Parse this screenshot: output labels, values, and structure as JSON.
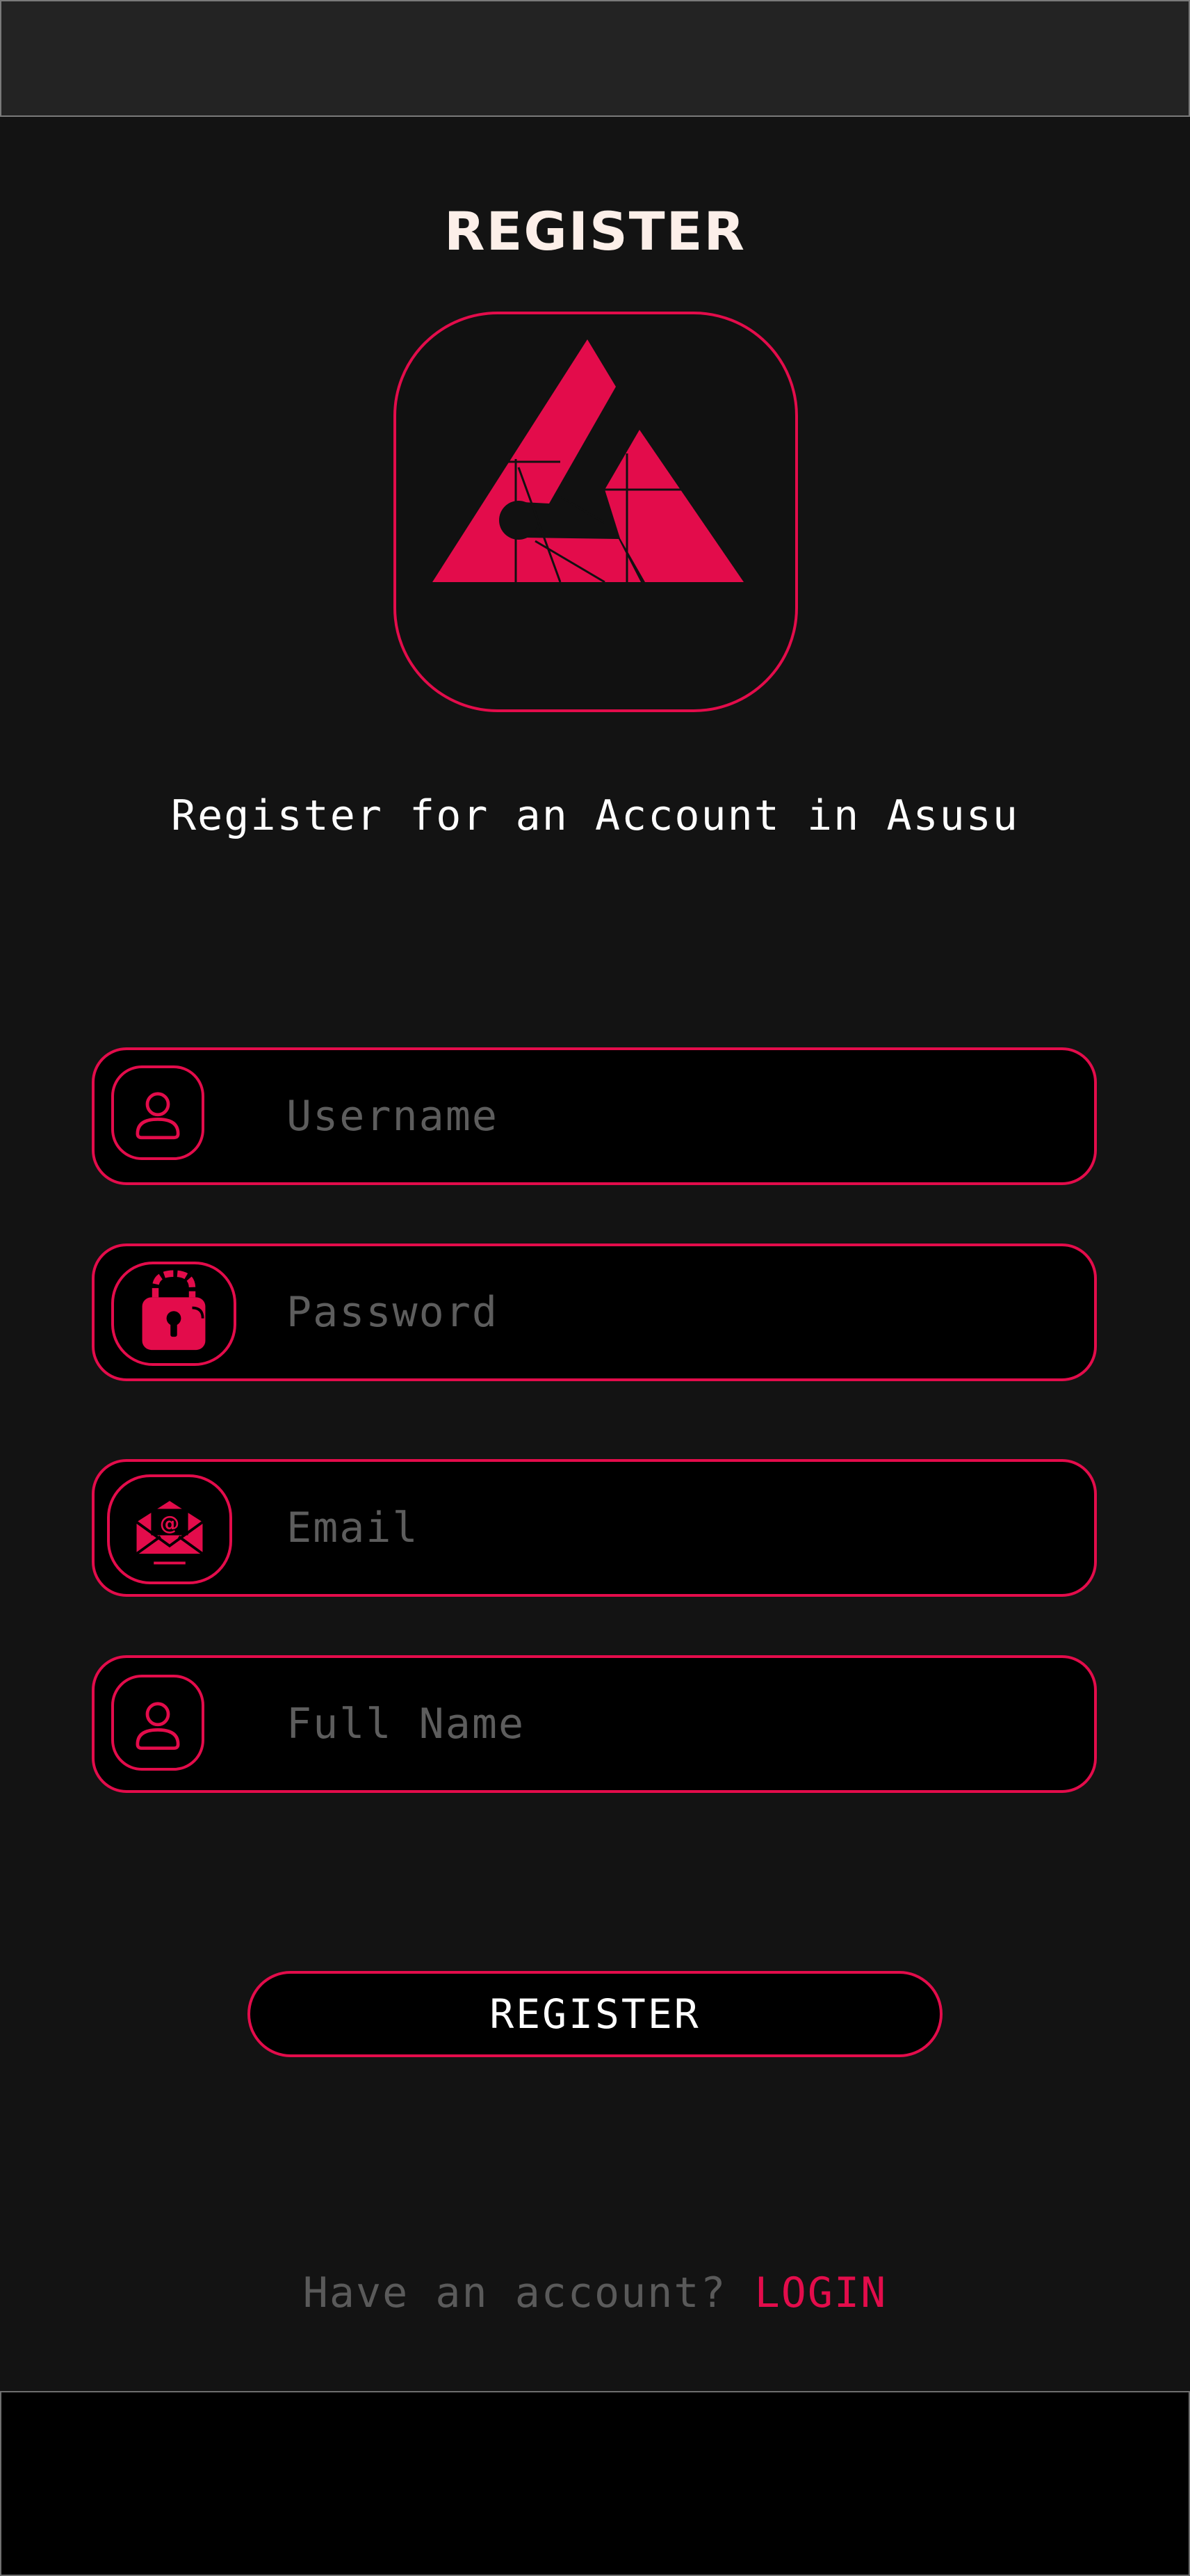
{
  "page": {
    "title": "REGISTER",
    "subtitle": "Register for an Account in Asusu"
  },
  "logo": {
    "name": "asusu-logo-icon"
  },
  "form": {
    "username": {
      "placeholder": "Username",
      "value": "",
      "icon": "user-icon"
    },
    "password": {
      "placeholder": "Password",
      "value": "",
      "icon": "lock-icon"
    },
    "email": {
      "placeholder": "Email",
      "value": "",
      "icon": "mail-icon"
    },
    "full_name": {
      "placeholder": "Full Name",
      "value": "",
      "icon": "user-icon"
    }
  },
  "register_button": "REGISTER",
  "footer": {
    "prompt": "Have an account?",
    "login_link": "LOGIN"
  },
  "colors": {
    "accent": "#e30c4b",
    "background": "#131313",
    "field_background": "#000000",
    "placeholder": "#5d5d5d",
    "title": "#fcefe9"
  }
}
